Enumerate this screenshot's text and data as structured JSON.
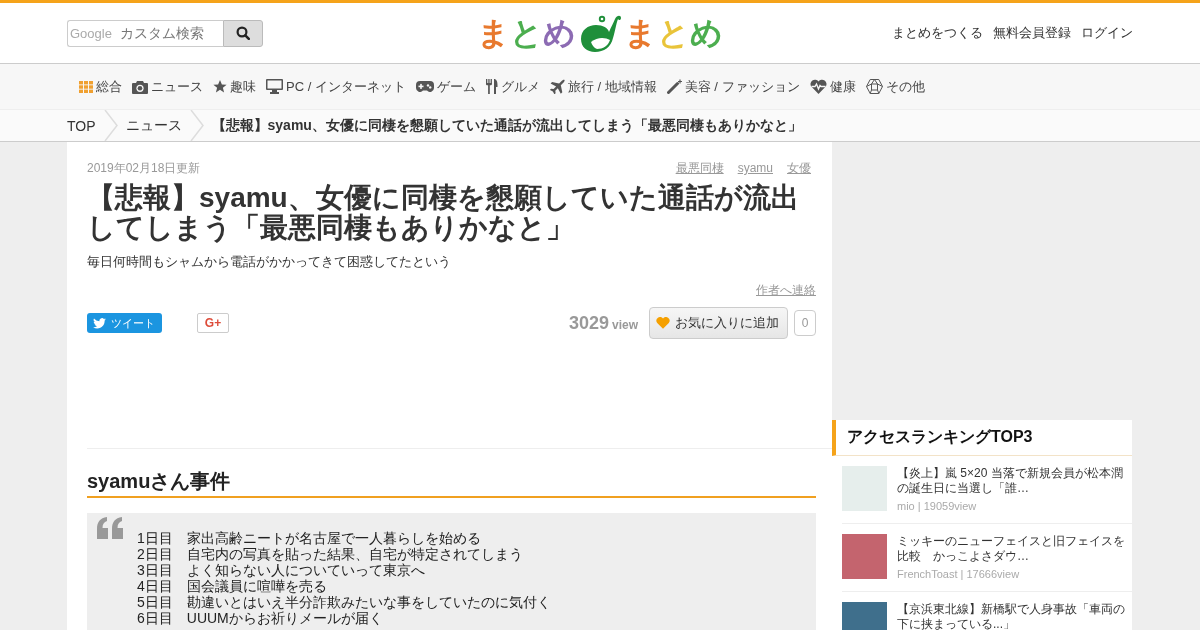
{
  "header": {
    "search": {
      "brand": "Google",
      "placeholder": "カスタム検索"
    },
    "logo": {
      "left": "まとめ",
      "right": "まとめ"
    },
    "links": [
      "まとめをつくる",
      "無料会員登録",
      "ログイン"
    ]
  },
  "nav": [
    {
      "label": "総合"
    },
    {
      "label": "ニュース"
    },
    {
      "label": "趣味"
    },
    {
      "label": "PC / インターネット"
    },
    {
      "label": "ゲーム"
    },
    {
      "label": "グルメ"
    },
    {
      "label": "旅行 / 地域情報"
    },
    {
      "label": "美容 / ファッション"
    },
    {
      "label": "健康"
    },
    {
      "label": "その他"
    }
  ],
  "breadcrumb": [
    {
      "label": "TOP",
      "current": false
    },
    {
      "label": "ニュース",
      "current": false
    },
    {
      "label": "【悲報】syamu、女優に同棲を懇願していた通話が流出してしまう「最悪同棲もありかなと」",
      "current": true
    }
  ],
  "article": {
    "updated": "2019年02月18日更新",
    "tags": [
      "最悪同棲",
      "syamu",
      "女優"
    ],
    "title": "【悲報】syamu、女優に同棲を懇願していた通話が流出してしまう「最悪同棲もありかなと」",
    "lead": "毎日何時間もシャムから電話がかかってきて困惑してたという",
    "contact": "作者へ連絡",
    "tweet_label": "ツイート",
    "plus_label": "G+",
    "views": "3029",
    "views_unit": "view",
    "favorite_label": "お気に入りに追加",
    "favorite_count": "0",
    "section_heading": "syamuさん事件",
    "quote_lines": [
      "1日目　家出高齢ニートが名古屋で一人暮らしを始める",
      "2日目　自宅内の写真を貼った結果、自宅が特定されてしまう",
      "3日目　よく知らない人についていって東京へ",
      "4日目　国会議員に喧嘩を売る",
      "5日目　勘違いとはいえ半分詐欺みたいな事をしていたのに気付く",
      "6日目　UUUMからお祈りメールが届く"
    ]
  },
  "sidebar": {
    "ranking": {
      "title": "アクセスランキングTOP3",
      "items": [
        {
          "title": "【炎上】嵐 5×20 当落で新規会員が松本潤の誕生日に当選し「誰…",
          "meta": "mio | 19059view"
        },
        {
          "title": "ミッキーのニューフェイスと旧フェイスを比較　かっこよさダウ…",
          "meta": "FrenchToast | 17666view"
        },
        {
          "title": "【京浜東北線】新橋駅で人身事故「車両の下に挟まっている...」"
        }
      ]
    }
  }
}
